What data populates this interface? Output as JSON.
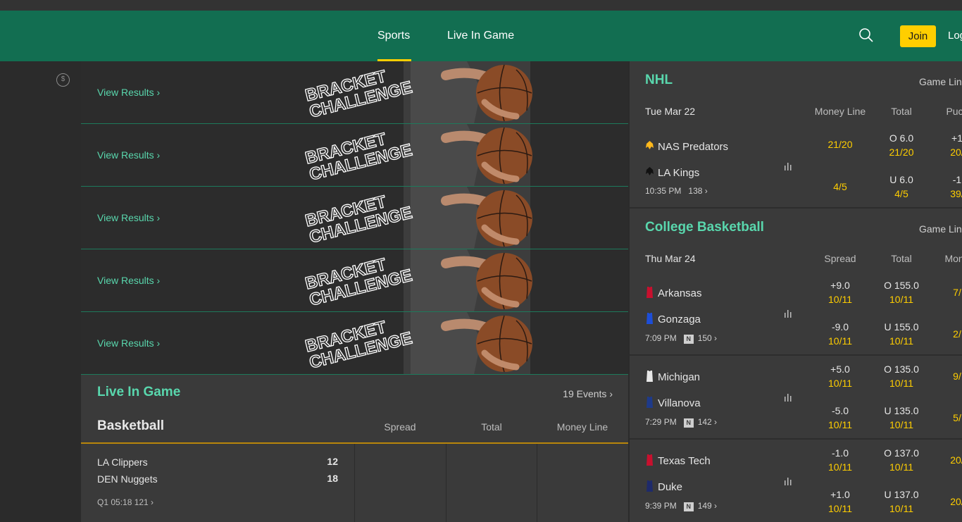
{
  "nav": {
    "sports_label": "Sports",
    "live_label": "Live In Game",
    "join_label": "Join",
    "login_label": "Log"
  },
  "banners": {
    "link_label": "View Results ›",
    "art_line1": "BRACKET",
    "art_line2": "CHALLENGE"
  },
  "live_in_game": {
    "title": "Live In Game",
    "events": "19 Events ›",
    "sport": "Basketball",
    "columns": [
      "Spread",
      "Total",
      "Money Line"
    ],
    "game": {
      "team1": "LA Clippers",
      "score1": "12",
      "team2": "DEN Nuggets",
      "score2": "18",
      "meta": "Q1 05:18   121 ›"
    }
  },
  "nhl": {
    "title": "NHL",
    "game_lines": "Game Lines",
    "date": "Tue Mar 22",
    "columns": [
      "Money Line",
      "Total",
      "Puck"
    ],
    "game": {
      "team1": "NAS Predators",
      "team2": "LA Kings",
      "time": "10:35 PM",
      "count": "138 ›",
      "ml1": "21/20",
      "ml2": "4/5",
      "tot1_top": "O 6.0",
      "tot1_bot": "21/20",
      "tot2_top": "U 6.0",
      "tot2_bot": "4/5",
      "pk1_top": "+1",
      "pk1_bot": "20/",
      "pk2_top": "-1",
      "pk2_bot": "39/"
    }
  },
  "cbb": {
    "title": "College Basketball",
    "game_lines": "Game Lines",
    "date": "Thu Mar 24",
    "columns": [
      "Spread",
      "Total",
      "Mone"
    ],
    "badge": "N",
    "games": [
      {
        "team1": "Arkansas",
        "team2": "Gonzaga",
        "time": "7:09 PM",
        "count": "150 ›",
        "sp1_top": "+9.0",
        "sp1_bot": "10/11",
        "sp2_top": "-9.0",
        "sp2_bot": "10/11",
        "t1_top": "O 155.0",
        "t1_bot": "10/11",
        "t2_top": "U 155.0",
        "t2_bot": "10/11",
        "ml1": "7/",
        "ml2": "2/",
        "c1": "#c8102e",
        "c2": "#1d4ed8"
      },
      {
        "team1": "Michigan",
        "team2": "Villanova",
        "time": "7:29 PM",
        "count": "142 ›",
        "sp1_top": "+5.0",
        "sp1_bot": "10/11",
        "sp2_top": "-5.0",
        "sp2_bot": "10/11",
        "t1_top": "O 135.0",
        "t1_bot": "10/11",
        "t2_top": "U 135.0",
        "t2_bot": "10/11",
        "ml1": "9/",
        "ml2": "5/",
        "c1": "#e8e8e8",
        "c2": "#1e3a8a"
      },
      {
        "team1": "Texas Tech",
        "team2": "Duke",
        "time": "9:39 PM",
        "count": "149 ›",
        "sp1_top": "-1.0",
        "sp1_bot": "10/11",
        "sp2_top": "+1.0",
        "sp2_bot": "10/11",
        "t1_top": "O 137.0",
        "t1_bot": "10/11",
        "t2_top": "U 137.0",
        "t2_bot": "10/11",
        "ml1": "20/",
        "ml2": "20/",
        "c1": "#c8102e",
        "c2": "#1e2a6b"
      }
    ]
  },
  "colors": {
    "brand_green": "#126e51",
    "accent_teal": "#59d7ad",
    "accent_yellow": "#ffce00"
  }
}
